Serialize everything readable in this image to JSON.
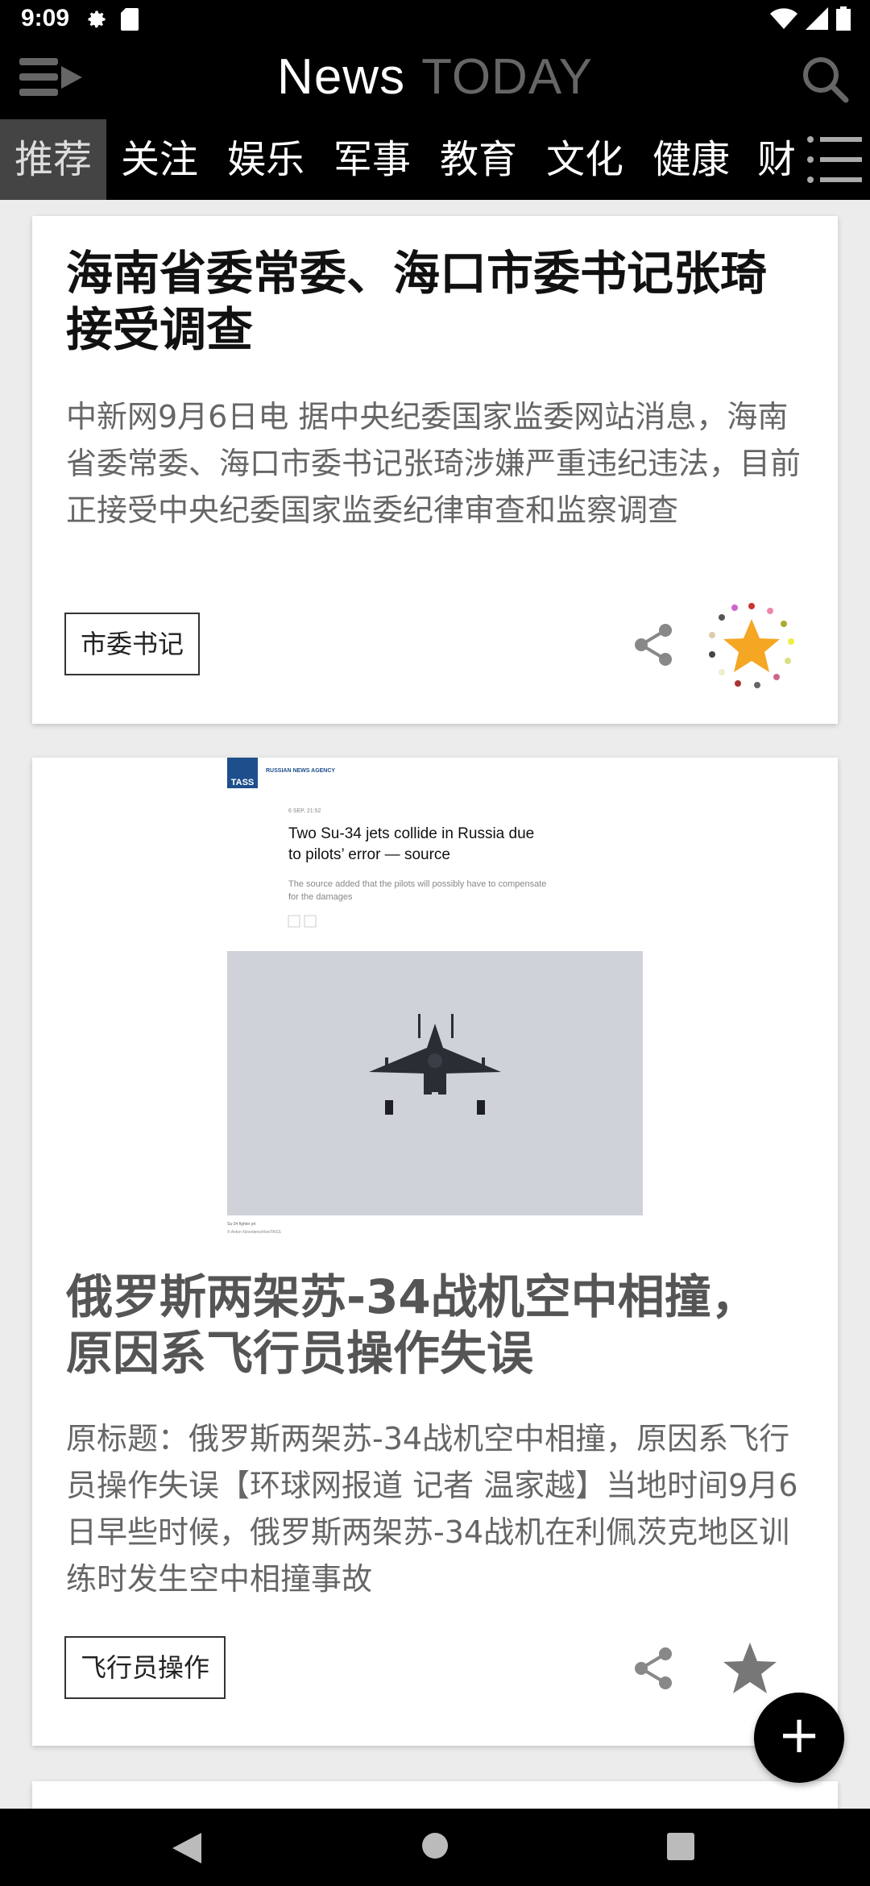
{
  "status_bar": {
    "time": "9:09"
  },
  "app_bar": {
    "title_news": "News",
    "title_today": "TODAY"
  },
  "tabs": [
    {
      "label": "推荐",
      "active": true
    },
    {
      "label": "关注"
    },
    {
      "label": "娱乐"
    },
    {
      "label": "军事"
    },
    {
      "label": "教育"
    },
    {
      "label": "文化"
    },
    {
      "label": "健康"
    },
    {
      "label": "财"
    }
  ],
  "articles": [
    {
      "headline": "海南省委常委、海口市委书记张琦接受调查",
      "summary": "中新网9月6日电 据中央纪委国家监委网站消息，海南省委常委、海口市委书记张琦涉嫌严重违纪违法，目前正接受中央纪委国家监委纪律审查和监察调查",
      "tag": "市委书记"
    },
    {
      "image": {
        "agency": "RUSSIAN NEWS AGENCY",
        "logo": "TASS",
        "date": "6 SEP, 21:52",
        "headline": "Two Su-34 jets collide in Russia due to pilots’ error — source",
        "subtext": "The source added that the pilots will possibly have to compensate for the damages",
        "caption": "Su-34 fighter jet",
        "credit": "© Anton Novoderezhkin/TASS"
      },
      "headline": "俄罗斯两架苏-34战机空中相撞，原因系飞行员操作失误",
      "summary": "原标题：俄罗斯两架苏-34战机空中相撞，原因系飞行员操作失误【环球网报道 记者 温家越】当地时间9月6日早些时候，俄罗斯两架苏-34战机在利佩茨克地区训练时发生空中相撞事故",
      "tag": "飞行员操作"
    }
  ],
  "icons": {
    "menu": "menu-arrow-icon",
    "search": "search-icon",
    "share": "share-icon",
    "star": "star-icon",
    "add": "plus-icon"
  },
  "colors": {
    "accent_star": "#f5a623",
    "bar": "#000000"
  }
}
